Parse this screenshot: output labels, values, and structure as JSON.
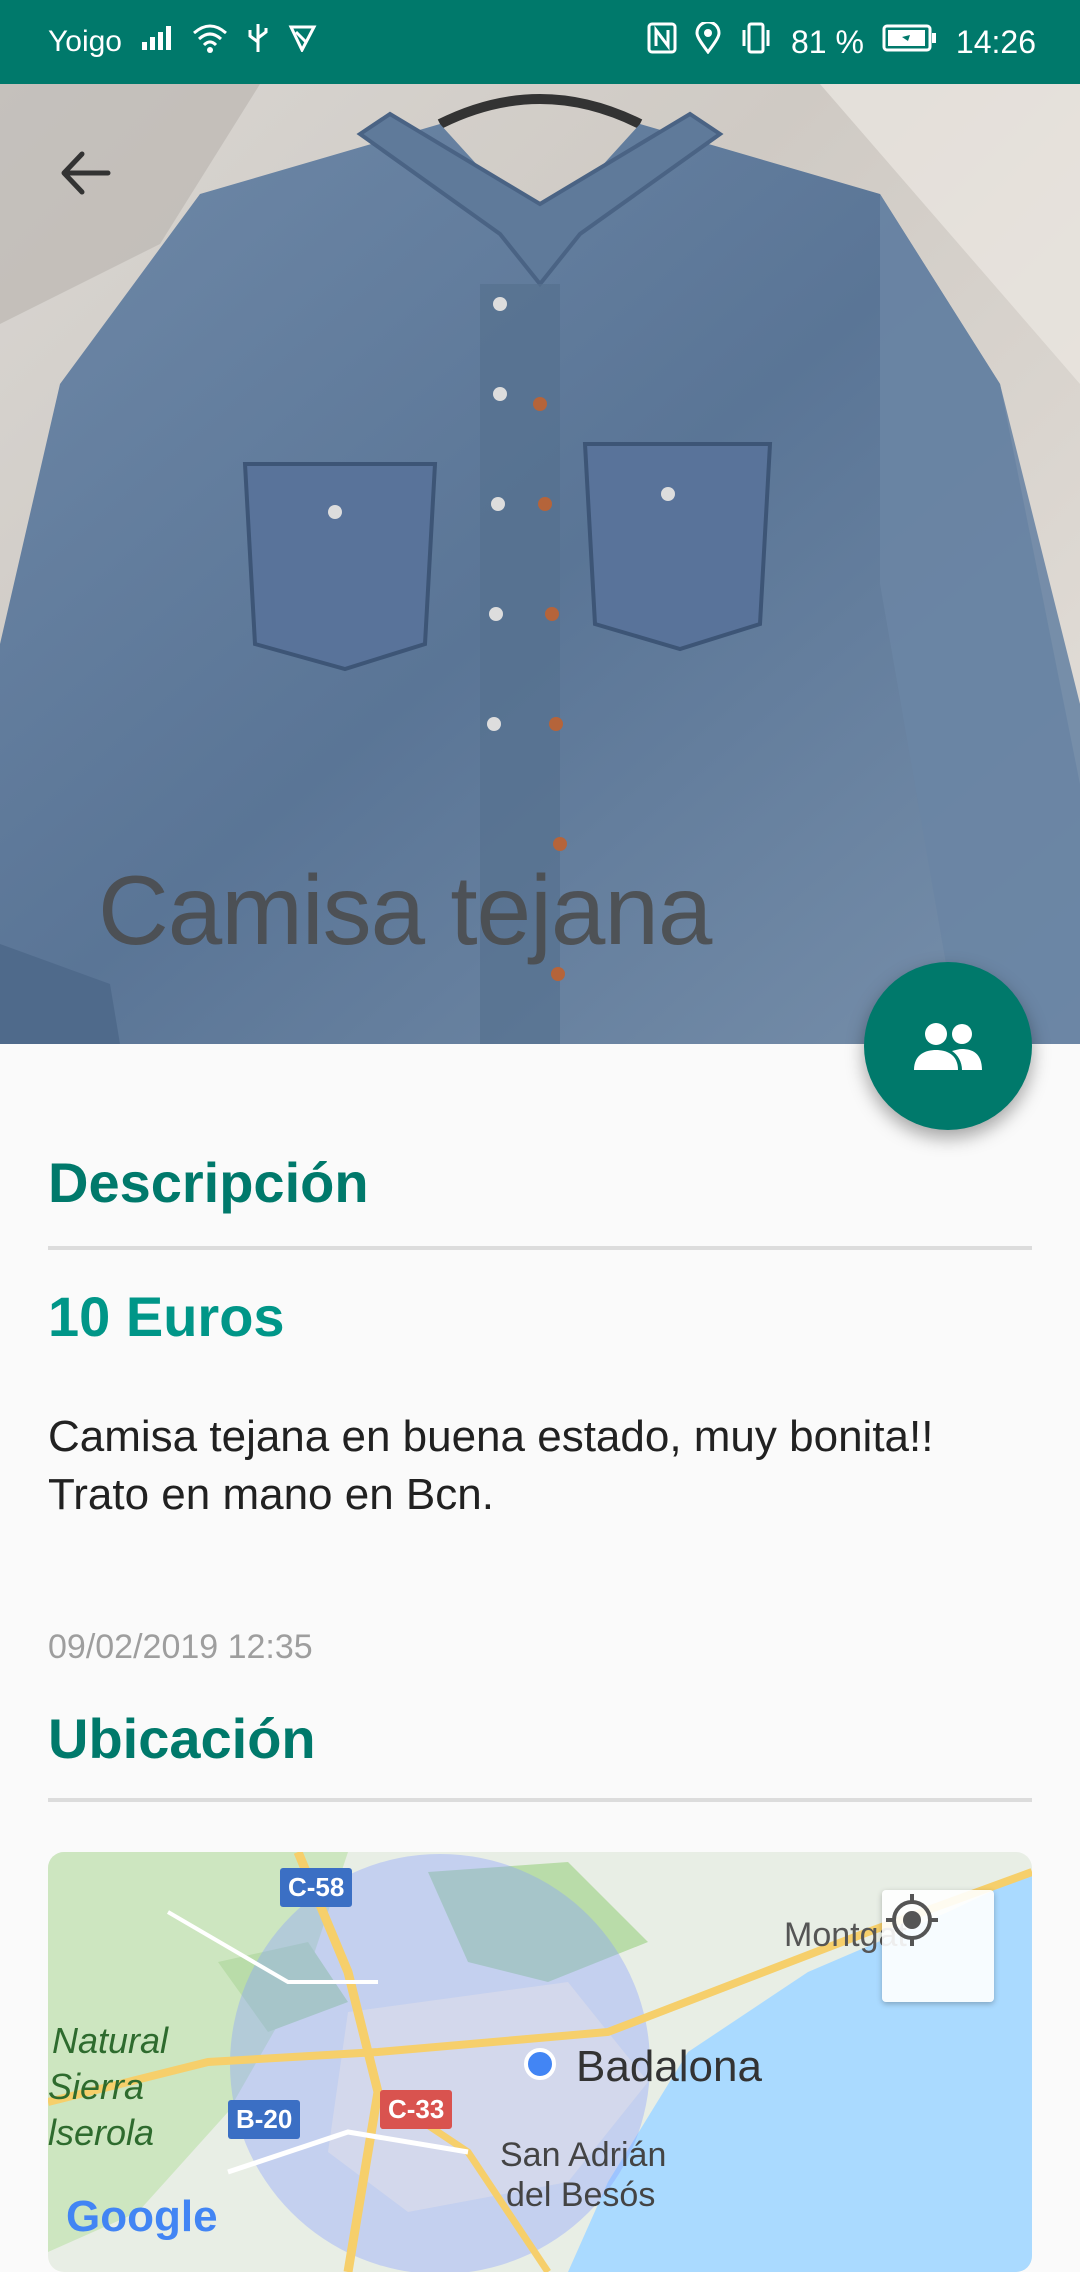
{
  "status_bar": {
    "carrier": "Yoigo",
    "battery": "81 %",
    "time": "14:26",
    "icons": [
      "signal-icon",
      "wifi-icon",
      "usb-icon",
      "cast-icon",
      "nfc-icon",
      "location-icon",
      "vibrate-icon",
      "battery-icon"
    ]
  },
  "header": {
    "title": "Camisa tejana",
    "back_icon": "arrow-back-icon",
    "fab_icon": "people-icon"
  },
  "description": {
    "heading": "Descripción",
    "price": "10 Euros",
    "text": "Camisa tejana en buena estado, muy bonita!!\nTrato en mano en Bcn.",
    "date": "09/02/2019  12:35"
  },
  "location": {
    "heading": "Ubicación",
    "map": {
      "labels": {
        "city": "Badalona",
        "town": "Montgat",
        "area1": "San Adrián",
        "area2": "del Besós",
        "park1": "Natural",
        "park2": "Sierra",
        "park3": "lserola"
      },
      "roads": [
        "C-58",
        "B-20",
        "C-33"
      ],
      "attribution": "Google"
    }
  },
  "colors": {
    "primary": "#00796b",
    "accent": "#009688"
  }
}
